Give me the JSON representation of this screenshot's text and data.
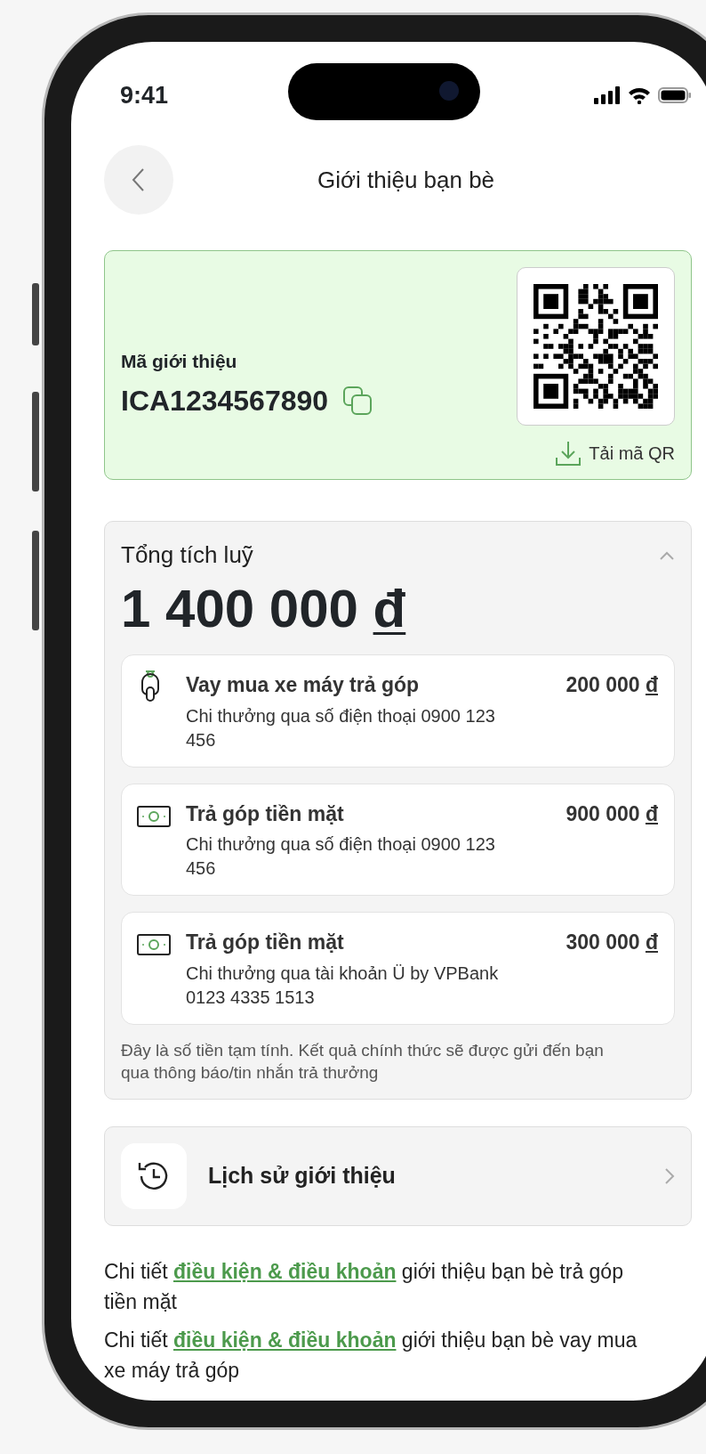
{
  "status_bar": {
    "time": "9:41"
  },
  "header": {
    "title": "Giới thiệu bạn bè"
  },
  "referral": {
    "label": "Mã giới thiệu",
    "code": "ICA1234567890",
    "download_label": "Tải mã QR"
  },
  "total": {
    "title": "Tổng tích luỹ",
    "expanded": true,
    "amount": "1 400 000",
    "currency": "đ",
    "items": [
      {
        "kind": "motorbike",
        "title": "Vay mua xe máy trả góp",
        "amount": "200 000",
        "currency": "đ",
        "detail": "Chi thưởng qua số điện thoại 0900 123 456"
      },
      {
        "kind": "cash",
        "title": "Trả góp tiền mặt",
        "amount": "900 000",
        "currency": "đ",
        "detail": "Chi thưởng qua số điện thoại 0900 123 456"
      },
      {
        "kind": "cash",
        "title": "Trả góp tiền mặt",
        "amount": "300 000",
        "currency": "đ",
        "detail": "Chi thưởng qua tài khoản Ü by VPBank 0123 4335 1513"
      }
    ],
    "note": "Đây là số tiền tạm tính. Kết quả chính thức sẽ được gửi đến bạn qua thông báo/tin nhắn trả thưởng"
  },
  "history": {
    "label": "Lịch sử giới thiệu"
  },
  "terms": [
    {
      "before": "Chi tiết",
      "link": "điều kiện & điều khoản",
      "after": "giới thiệu bạn bè trả góp tiền mặt"
    },
    {
      "before": "Chi tiết",
      "link": "điều kiện & điều khoản",
      "after": "giới thiệu bạn bè vay mua xe máy trả góp"
    }
  ]
}
